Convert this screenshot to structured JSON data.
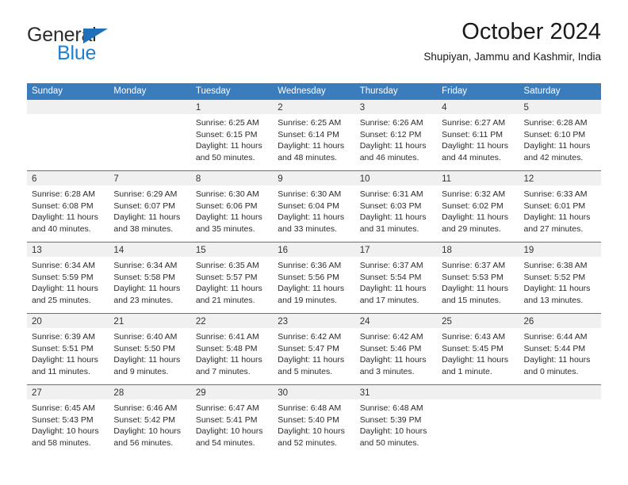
{
  "brand": {
    "line1": "General",
    "line2": "Blue",
    "colors": {
      "general": "#2b2b2b",
      "blue": "#1f7fd0",
      "triangle": "#1f6fba"
    }
  },
  "header": {
    "title": "October 2024",
    "subtitle": "Shupiyan, Jammu and Kashmir, India"
  },
  "theme": {
    "header_band": "#3b7cbd",
    "date_band": "#f0f0f0",
    "row_rule": "#3b7cbd",
    "text": "#2b2b2b"
  },
  "weekdays": [
    "Sunday",
    "Monday",
    "Tuesday",
    "Wednesday",
    "Thursday",
    "Friday",
    "Saturday"
  ],
  "weeks": [
    [
      {
        "day": ""
      },
      {
        "day": ""
      },
      {
        "day": "1",
        "sunrise": "Sunrise: 6:25 AM",
        "sunset": "Sunset: 6:15 PM",
        "daylight": "Daylight: 11 hours and 50 minutes."
      },
      {
        "day": "2",
        "sunrise": "Sunrise: 6:25 AM",
        "sunset": "Sunset: 6:14 PM",
        "daylight": "Daylight: 11 hours and 48 minutes."
      },
      {
        "day": "3",
        "sunrise": "Sunrise: 6:26 AM",
        "sunset": "Sunset: 6:12 PM",
        "daylight": "Daylight: 11 hours and 46 minutes."
      },
      {
        "day": "4",
        "sunrise": "Sunrise: 6:27 AM",
        "sunset": "Sunset: 6:11 PM",
        "daylight": "Daylight: 11 hours and 44 minutes."
      },
      {
        "day": "5",
        "sunrise": "Sunrise: 6:28 AM",
        "sunset": "Sunset: 6:10 PM",
        "daylight": "Daylight: 11 hours and 42 minutes."
      }
    ],
    [
      {
        "day": "6",
        "sunrise": "Sunrise: 6:28 AM",
        "sunset": "Sunset: 6:08 PM",
        "daylight": "Daylight: 11 hours and 40 minutes."
      },
      {
        "day": "7",
        "sunrise": "Sunrise: 6:29 AM",
        "sunset": "Sunset: 6:07 PM",
        "daylight": "Daylight: 11 hours and 38 minutes."
      },
      {
        "day": "8",
        "sunrise": "Sunrise: 6:30 AM",
        "sunset": "Sunset: 6:06 PM",
        "daylight": "Daylight: 11 hours and 35 minutes."
      },
      {
        "day": "9",
        "sunrise": "Sunrise: 6:30 AM",
        "sunset": "Sunset: 6:04 PM",
        "daylight": "Daylight: 11 hours and 33 minutes."
      },
      {
        "day": "10",
        "sunrise": "Sunrise: 6:31 AM",
        "sunset": "Sunset: 6:03 PM",
        "daylight": "Daylight: 11 hours and 31 minutes."
      },
      {
        "day": "11",
        "sunrise": "Sunrise: 6:32 AM",
        "sunset": "Sunset: 6:02 PM",
        "daylight": "Daylight: 11 hours and 29 minutes."
      },
      {
        "day": "12",
        "sunrise": "Sunrise: 6:33 AM",
        "sunset": "Sunset: 6:01 PM",
        "daylight": "Daylight: 11 hours and 27 minutes."
      }
    ],
    [
      {
        "day": "13",
        "sunrise": "Sunrise: 6:34 AM",
        "sunset": "Sunset: 5:59 PM",
        "daylight": "Daylight: 11 hours and 25 minutes."
      },
      {
        "day": "14",
        "sunrise": "Sunrise: 6:34 AM",
        "sunset": "Sunset: 5:58 PM",
        "daylight": "Daylight: 11 hours and 23 minutes."
      },
      {
        "day": "15",
        "sunrise": "Sunrise: 6:35 AM",
        "sunset": "Sunset: 5:57 PM",
        "daylight": "Daylight: 11 hours and 21 minutes."
      },
      {
        "day": "16",
        "sunrise": "Sunrise: 6:36 AM",
        "sunset": "Sunset: 5:56 PM",
        "daylight": "Daylight: 11 hours and 19 minutes."
      },
      {
        "day": "17",
        "sunrise": "Sunrise: 6:37 AM",
        "sunset": "Sunset: 5:54 PM",
        "daylight": "Daylight: 11 hours and 17 minutes."
      },
      {
        "day": "18",
        "sunrise": "Sunrise: 6:37 AM",
        "sunset": "Sunset: 5:53 PM",
        "daylight": "Daylight: 11 hours and 15 minutes."
      },
      {
        "day": "19",
        "sunrise": "Sunrise: 6:38 AM",
        "sunset": "Sunset: 5:52 PM",
        "daylight": "Daylight: 11 hours and 13 minutes."
      }
    ],
    [
      {
        "day": "20",
        "sunrise": "Sunrise: 6:39 AM",
        "sunset": "Sunset: 5:51 PM",
        "daylight": "Daylight: 11 hours and 11 minutes."
      },
      {
        "day": "21",
        "sunrise": "Sunrise: 6:40 AM",
        "sunset": "Sunset: 5:50 PM",
        "daylight": "Daylight: 11 hours and 9 minutes."
      },
      {
        "day": "22",
        "sunrise": "Sunrise: 6:41 AM",
        "sunset": "Sunset: 5:48 PM",
        "daylight": "Daylight: 11 hours and 7 minutes."
      },
      {
        "day": "23",
        "sunrise": "Sunrise: 6:42 AM",
        "sunset": "Sunset: 5:47 PM",
        "daylight": "Daylight: 11 hours and 5 minutes."
      },
      {
        "day": "24",
        "sunrise": "Sunrise: 6:42 AM",
        "sunset": "Sunset: 5:46 PM",
        "daylight": "Daylight: 11 hours and 3 minutes."
      },
      {
        "day": "25",
        "sunrise": "Sunrise: 6:43 AM",
        "sunset": "Sunset: 5:45 PM",
        "daylight": "Daylight: 11 hours and 1 minute."
      },
      {
        "day": "26",
        "sunrise": "Sunrise: 6:44 AM",
        "sunset": "Sunset: 5:44 PM",
        "daylight": "Daylight: 11 hours and 0 minutes."
      }
    ],
    [
      {
        "day": "27",
        "sunrise": "Sunrise: 6:45 AM",
        "sunset": "Sunset: 5:43 PM",
        "daylight": "Daylight: 10 hours and 58 minutes."
      },
      {
        "day": "28",
        "sunrise": "Sunrise: 6:46 AM",
        "sunset": "Sunset: 5:42 PM",
        "daylight": "Daylight: 10 hours and 56 minutes."
      },
      {
        "day": "29",
        "sunrise": "Sunrise: 6:47 AM",
        "sunset": "Sunset: 5:41 PM",
        "daylight": "Daylight: 10 hours and 54 minutes."
      },
      {
        "day": "30",
        "sunrise": "Sunrise: 6:48 AM",
        "sunset": "Sunset: 5:40 PM",
        "daylight": "Daylight: 10 hours and 52 minutes."
      },
      {
        "day": "31",
        "sunrise": "Sunrise: 6:48 AM",
        "sunset": "Sunset: 5:39 PM",
        "daylight": "Daylight: 10 hours and 50 minutes."
      },
      {
        "day": ""
      },
      {
        "day": ""
      }
    ]
  ]
}
